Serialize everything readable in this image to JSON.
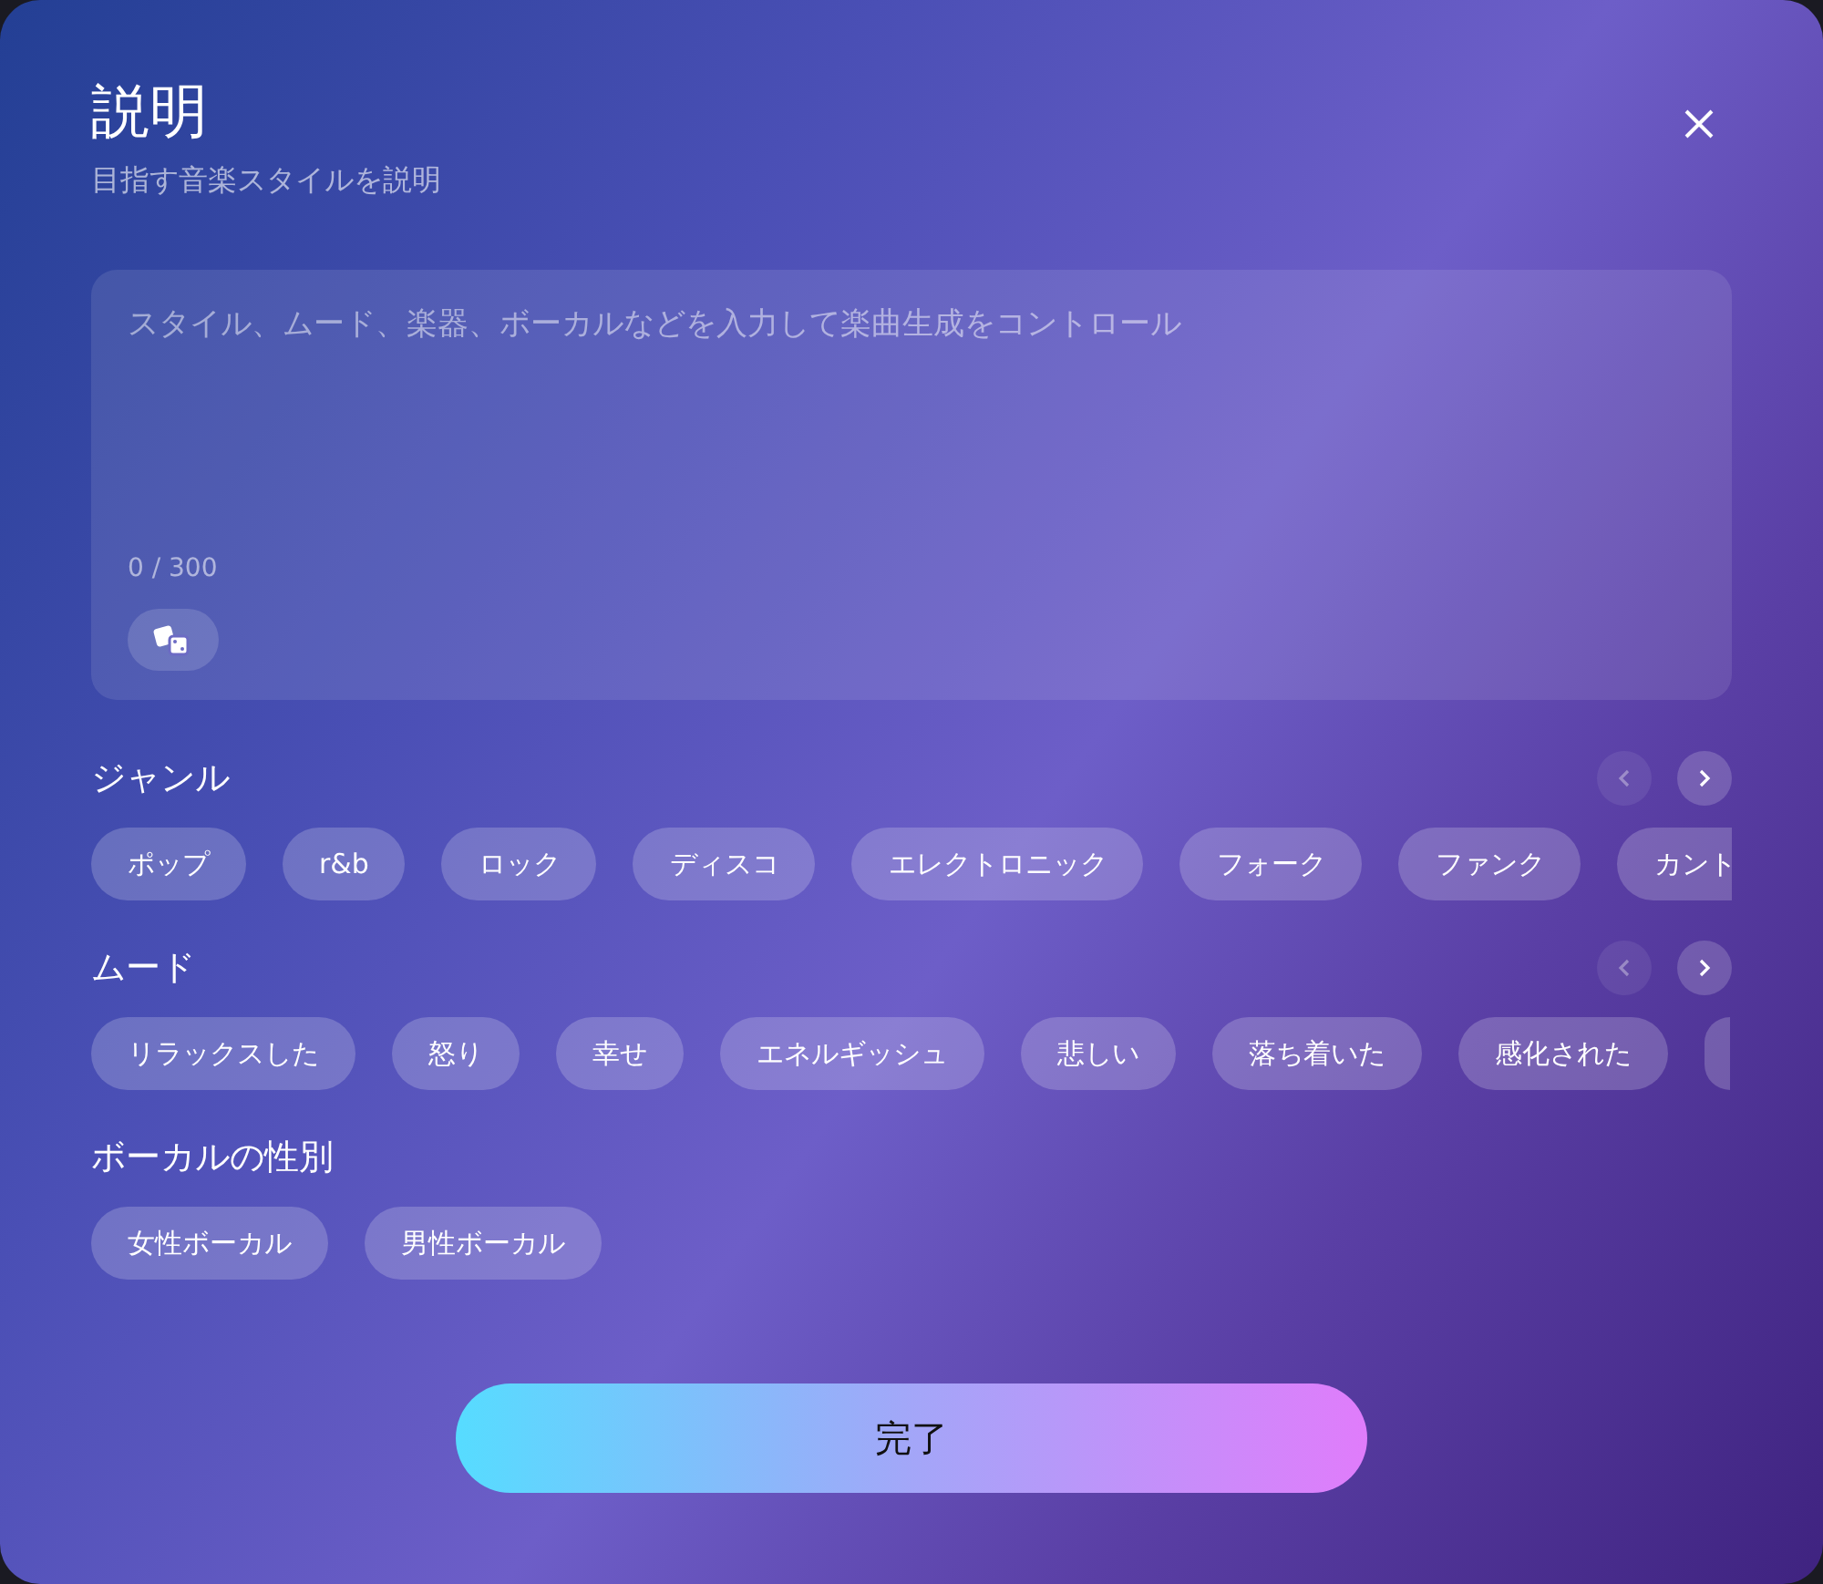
{
  "dialog": {
    "title": "説明",
    "subtitle": "目指す音楽スタイルを説明"
  },
  "prompt": {
    "placeholder": "スタイル、ムード、楽器、ボーカルなどを入力して楽曲生成をコントロール",
    "counter": "0 / 300"
  },
  "sections": [
    {
      "title": "ジャンル",
      "nav": {
        "prev_disabled": true,
        "next_disabled": false
      },
      "overflow": true,
      "chips": [
        {
          "label": "ポップ"
        },
        {
          "label": "r&b"
        },
        {
          "label": "ロック"
        },
        {
          "label": "ディスコ"
        },
        {
          "label": "エレクトロニック"
        },
        {
          "label": "フォーク"
        },
        {
          "label": "ファンク"
        },
        {
          "label": "カント"
        }
      ]
    },
    {
      "title": "ムード",
      "nav": {
        "prev_disabled": true,
        "next_disabled": false
      },
      "overflow": true,
      "trailing_stub": true,
      "chips": [
        {
          "label": "リラックスした"
        },
        {
          "label": "怒り"
        },
        {
          "label": "幸せ"
        },
        {
          "label": "エネルギッシュ"
        },
        {
          "label": "悲しい"
        },
        {
          "label": "落ち着いた"
        },
        {
          "label": "感化された"
        }
      ]
    },
    {
      "title": "ボーカルの性別",
      "overflow": false,
      "chips": [
        {
          "label": "女性ボーカル"
        },
        {
          "label": "男性ボーカル"
        }
      ]
    }
  ],
  "done_button": "完了"
}
